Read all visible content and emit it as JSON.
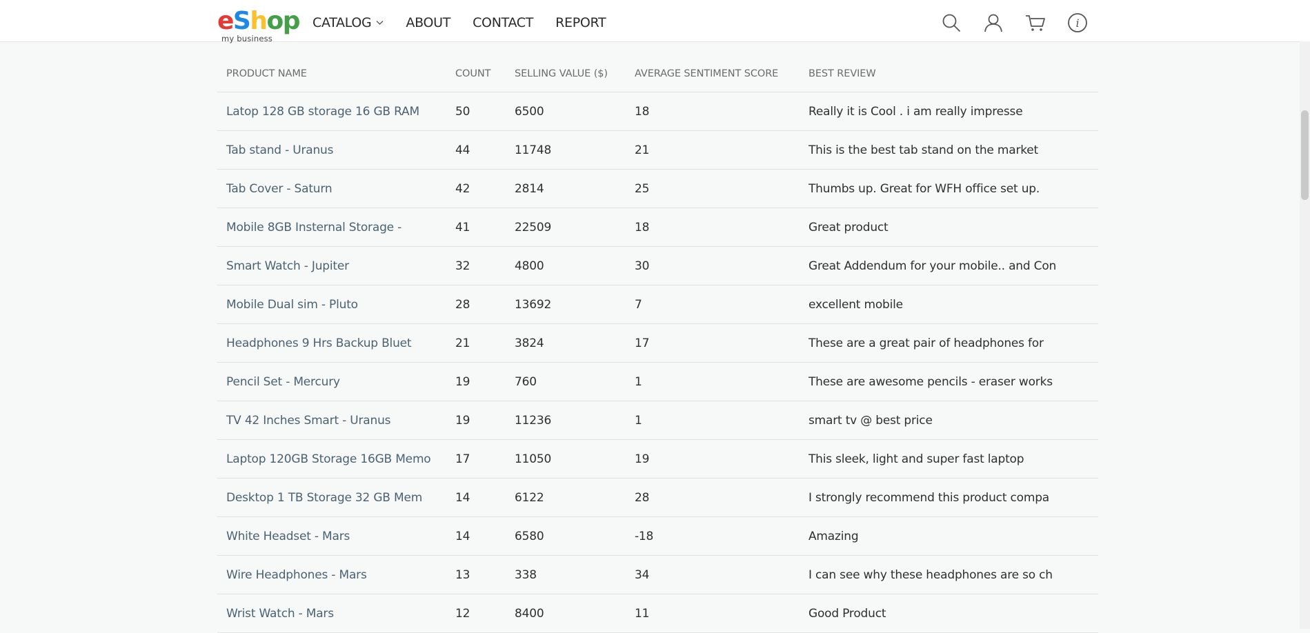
{
  "brand": {
    "letters": [
      {
        "ch": "e",
        "color": "#e53935"
      },
      {
        "ch": "S",
        "color": "#1e88e5"
      },
      {
        "ch": "h",
        "color": "#fbc02d"
      },
      {
        "ch": "o",
        "color": "#43a047"
      },
      {
        "ch": "p",
        "color": "#43a047"
      }
    ],
    "tagline": "my business"
  },
  "nav": {
    "catalog": "CATALOG",
    "about": "ABOUT",
    "contact": "CONTACT",
    "report": "REPORT"
  },
  "icons": [
    "search-icon",
    "user-icon",
    "cart-icon",
    "info-icon"
  ],
  "table": {
    "headers": [
      "PRODUCT NAME",
      "COUNT",
      "SELLING VALUE ($)",
      "AVERAGE SENTIMENT SCORE",
      "BEST REVIEW"
    ],
    "rows": [
      [
        "Latop 128 GB storage 16 GB RAM",
        "50",
        "6500",
        "18",
        "Really it is Cool . i am really impresse"
      ],
      [
        "Tab stand - Uranus",
        "44",
        "11748",
        "21",
        "This is the best tab stand on the market"
      ],
      [
        "Tab Cover - Saturn",
        "42",
        "2814",
        "25",
        "Thumbs up. Great for WFH office set up."
      ],
      [
        "Mobile 8GB Insternal Storage -",
        "41",
        "22509",
        "18",
        "Great product"
      ],
      [
        "Smart Watch - Jupiter",
        "32",
        "4800",
        "30",
        "Great Addendum for your mobile.. and Con"
      ],
      [
        "Mobile Dual sim - Pluto",
        "28",
        "13692",
        "7",
        "excellent mobile"
      ],
      [
        "Headphones 9 Hrs Backup Bluet",
        "21",
        "3824",
        "17",
        "These are a great pair of headphones for"
      ],
      [
        "Pencil Set - Mercury",
        "19",
        "760",
        "1",
        "These are awesome pencils - eraser works"
      ],
      [
        "TV 42 Inches Smart - Uranus",
        "19",
        "11236",
        "1",
        "smart tv @ best price"
      ],
      [
        "Laptop 120GB Storage 16GB Memo",
        "17",
        "11050",
        "19",
        "This sleek, light and super fast laptop"
      ],
      [
        "Desktop 1 TB Storage 32 GB Mem",
        "14",
        "6122",
        "28",
        "I strongly recommend this product compa"
      ],
      [
        "White Headset - Mars",
        "14",
        "6580",
        "-18",
        "Amazing"
      ],
      [
        "Wire Headphones - Mars",
        "13",
        "338",
        "34",
        "I can see why these headphones are so ch"
      ],
      [
        "Wrist Watch - Mars",
        "12",
        "8400",
        "11",
        "Good Product"
      ]
    ]
  }
}
